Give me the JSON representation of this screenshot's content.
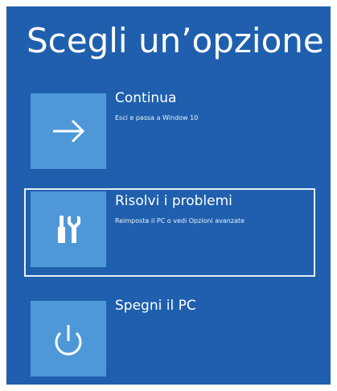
{
  "screen": {
    "title": "Scegli un’opzione"
  },
  "options": [
    {
      "label": "Continua",
      "description": "Esci e passa a Window 10",
      "icon": "arrow-right-icon"
    },
    {
      "label": "Risolvi i problemi",
      "description": "Reimposta il PC o vedi Opzioni avanzate",
      "icon": "tools-icon",
      "selected": true
    },
    {
      "label": "Spegni il PC",
      "description": "",
      "icon": "power-icon"
    }
  ],
  "colors": {
    "background": "#1f5fae",
    "tile": "#4f98d8",
    "text": "#ffffff"
  }
}
